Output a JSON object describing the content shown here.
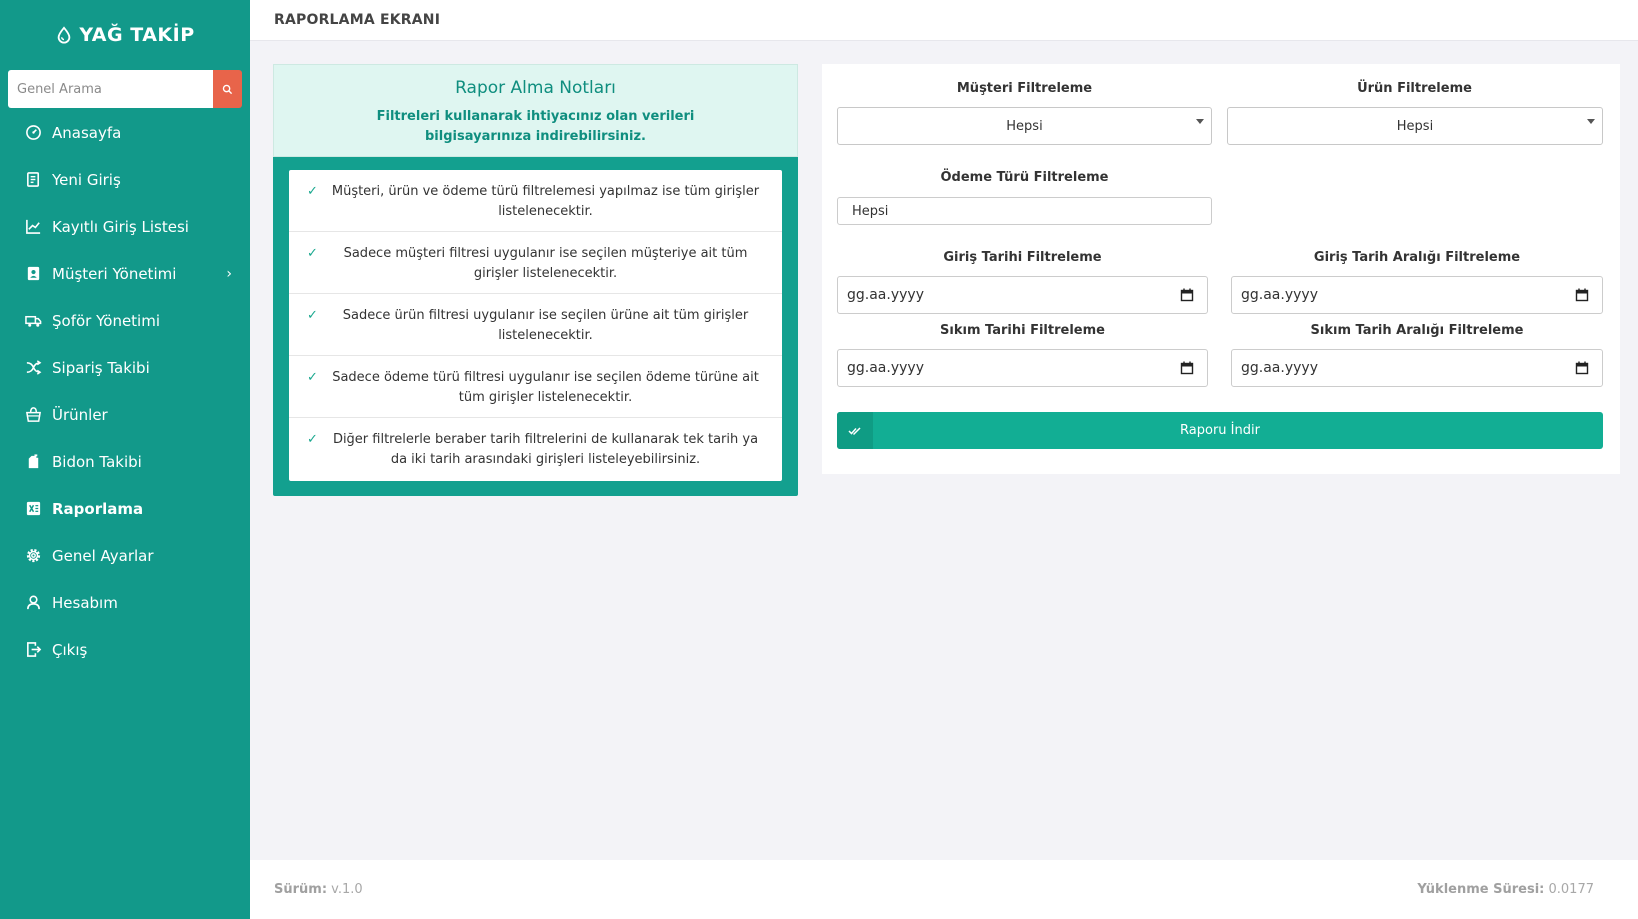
{
  "brand": {
    "name": "YAĞ TAKİP",
    "icon": "drop-icon"
  },
  "search": {
    "placeholder": "Genel Arama",
    "icon": "search-icon"
  },
  "sidebar": {
    "items": [
      {
        "label": "Anasayfa",
        "icon": "dashboard-icon"
      },
      {
        "label": "Yeni Giriş",
        "icon": "document-icon"
      },
      {
        "label": "Kayıtlı Giriş Listesi",
        "icon": "chart-line-icon"
      },
      {
        "label": "Müşteri Yönetimi",
        "icon": "contact-book-icon",
        "chevron": "›"
      },
      {
        "label": "Şoför Yönetimi",
        "icon": "truck-icon"
      },
      {
        "label": "Sipariş Takibi",
        "icon": "shuffle-icon"
      },
      {
        "label": "Ürünler",
        "icon": "basket-icon"
      },
      {
        "label": "Bidon Takibi",
        "icon": "canister-icon"
      },
      {
        "label": "Raporlama",
        "icon": "excel-icon",
        "active": true
      },
      {
        "label": "Genel Ayarlar",
        "icon": "gear-icon"
      },
      {
        "label": "Hesabım",
        "icon": "user-icon"
      },
      {
        "label": "Çıkış",
        "icon": "logout-icon"
      }
    ]
  },
  "header": {
    "title": "RAPORLAMA EKRANI"
  },
  "notes": {
    "title": "Rapor Alma Notları",
    "subtitle": "Filtreleri kullanarak ihtiyacınız olan verileri bilgisayarınıza indirebilirsiniz.",
    "items": [
      "Müşteri, ürün ve ödeme türü filtrelemesi yapılmaz ise tüm girişler listelenecektir.",
      "Sadece müşteri filtresi uygulanır ise seçilen müşteriye ait tüm girişler listelenecektir.",
      "Sadece ürün filtresi uygulanır ise seçilen ürüne ait tüm girişler listelenecektir.",
      "Sadece ödeme türü filtresi uygulanır ise seçilen ödeme türüne ait tüm girişler listelenecektir.",
      "Diğer filtrelerle beraber tarih filtrelerini de kullanarak tek tarih ya da iki tarih arasındaki girişleri listeleyebilirsiniz."
    ]
  },
  "filters": {
    "customer": {
      "label": "Müşteri Filtreleme",
      "value": "Hepsi"
    },
    "product": {
      "label": "Ürün Filtreleme",
      "value": "Hepsi"
    },
    "payment": {
      "label": "Ödeme Türü Filtreleme",
      "value": "Hepsi"
    },
    "entry_date": {
      "label": "Giriş Tarihi Filtreleme",
      "placeholder": "gg.aa.yyyy"
    },
    "entry_range": {
      "label": "Giriş Tarih Aralığı Filtreleme",
      "placeholder": "gg.aa.yyyy"
    },
    "press_date": {
      "label": "Sıkım Tarihi Filtreleme",
      "placeholder": "gg.aa.yyyy"
    },
    "press_range": {
      "label": "Sıkım Tarih Aralığı Filtreleme",
      "placeholder": "gg.aa.yyyy"
    },
    "download_button": "Raporu İndir"
  },
  "footer": {
    "version_label": "Sürüm:",
    "version_value": "v.1.0",
    "load_label": "Yüklenme Süresi:",
    "load_value": "0.0177"
  },
  "colors": {
    "sidebar": "#12998a",
    "accent": "#12ae94",
    "search_button": "#e8644a",
    "notes_head": "#dff6f1"
  }
}
